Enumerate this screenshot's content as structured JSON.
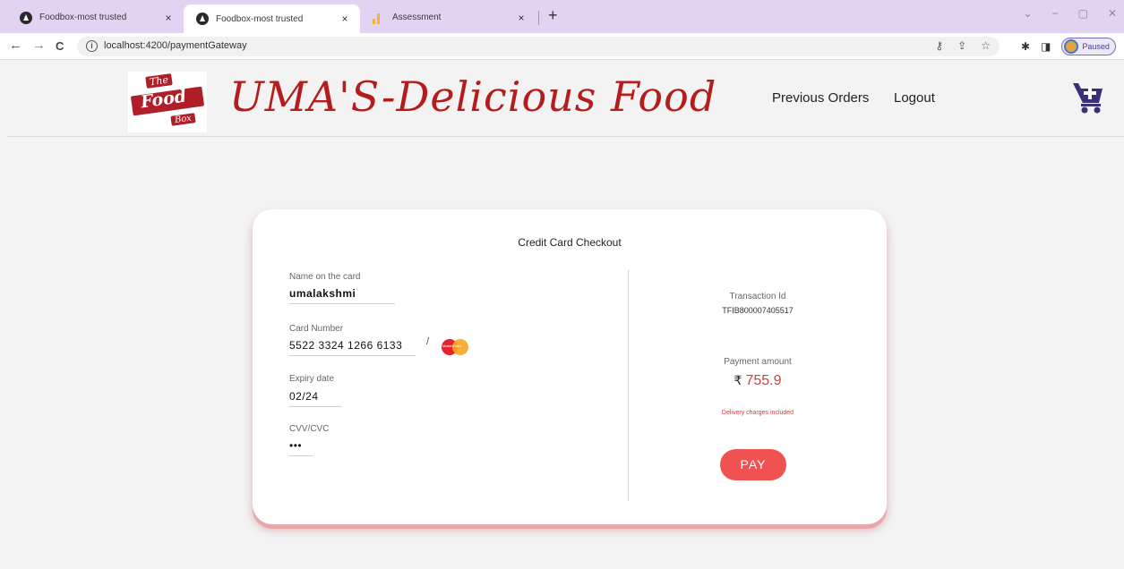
{
  "browser": {
    "tabs": [
      {
        "title": "Foodbox-most trusted",
        "close": "×"
      },
      {
        "title": "Foodbox-most trusted",
        "close": "×"
      },
      {
        "title": "Assessment",
        "close": "×"
      }
    ],
    "new_tab": "+",
    "window_controls": {
      "dropdown": "⌄",
      "minimize": "−",
      "maximize": "▢",
      "close": "✕"
    },
    "back": "←",
    "forward": "→",
    "reload": "C",
    "info": "i",
    "url": "localhost:4200/paymentGateway",
    "omni_icons": {
      "key": "⚷",
      "share": "⇪",
      "bookmark": "☆"
    },
    "extensions": "✱",
    "sidebar": "◨",
    "profile_label": "Paused",
    "menu": "⋮"
  },
  "header": {
    "logo": {
      "line1": "The",
      "line2": "Food",
      "line3": "Box"
    },
    "brand": "UMA'S-Delicious Food",
    "nav": {
      "previous_orders": "Previous Orders",
      "logout": "Logout"
    },
    "cart_icon": "cart-plus-icon",
    "accent": "#b51c1c"
  },
  "checkout": {
    "title": "Credit Card Checkout",
    "name_label": "Name on the card",
    "name_value": "umalakshmi",
    "card_label": "Card Number",
    "card_value": "5522 3324 1266 6133",
    "card_separator": "/",
    "card_brand": "MasterCard",
    "expiry_label": "Expiry date",
    "expiry_value": "02/24",
    "cvv_label": "CVV/CVC",
    "cvv_value": "•••",
    "transaction_label": "Transaction Id",
    "transaction_value": "TFIB800007405517",
    "amount_label": "Payment amount",
    "currency": "₹",
    "amount_value": "755.9",
    "note": "Delivery charges included",
    "pay_label": "PAY",
    "pay_color": "#f05252"
  }
}
